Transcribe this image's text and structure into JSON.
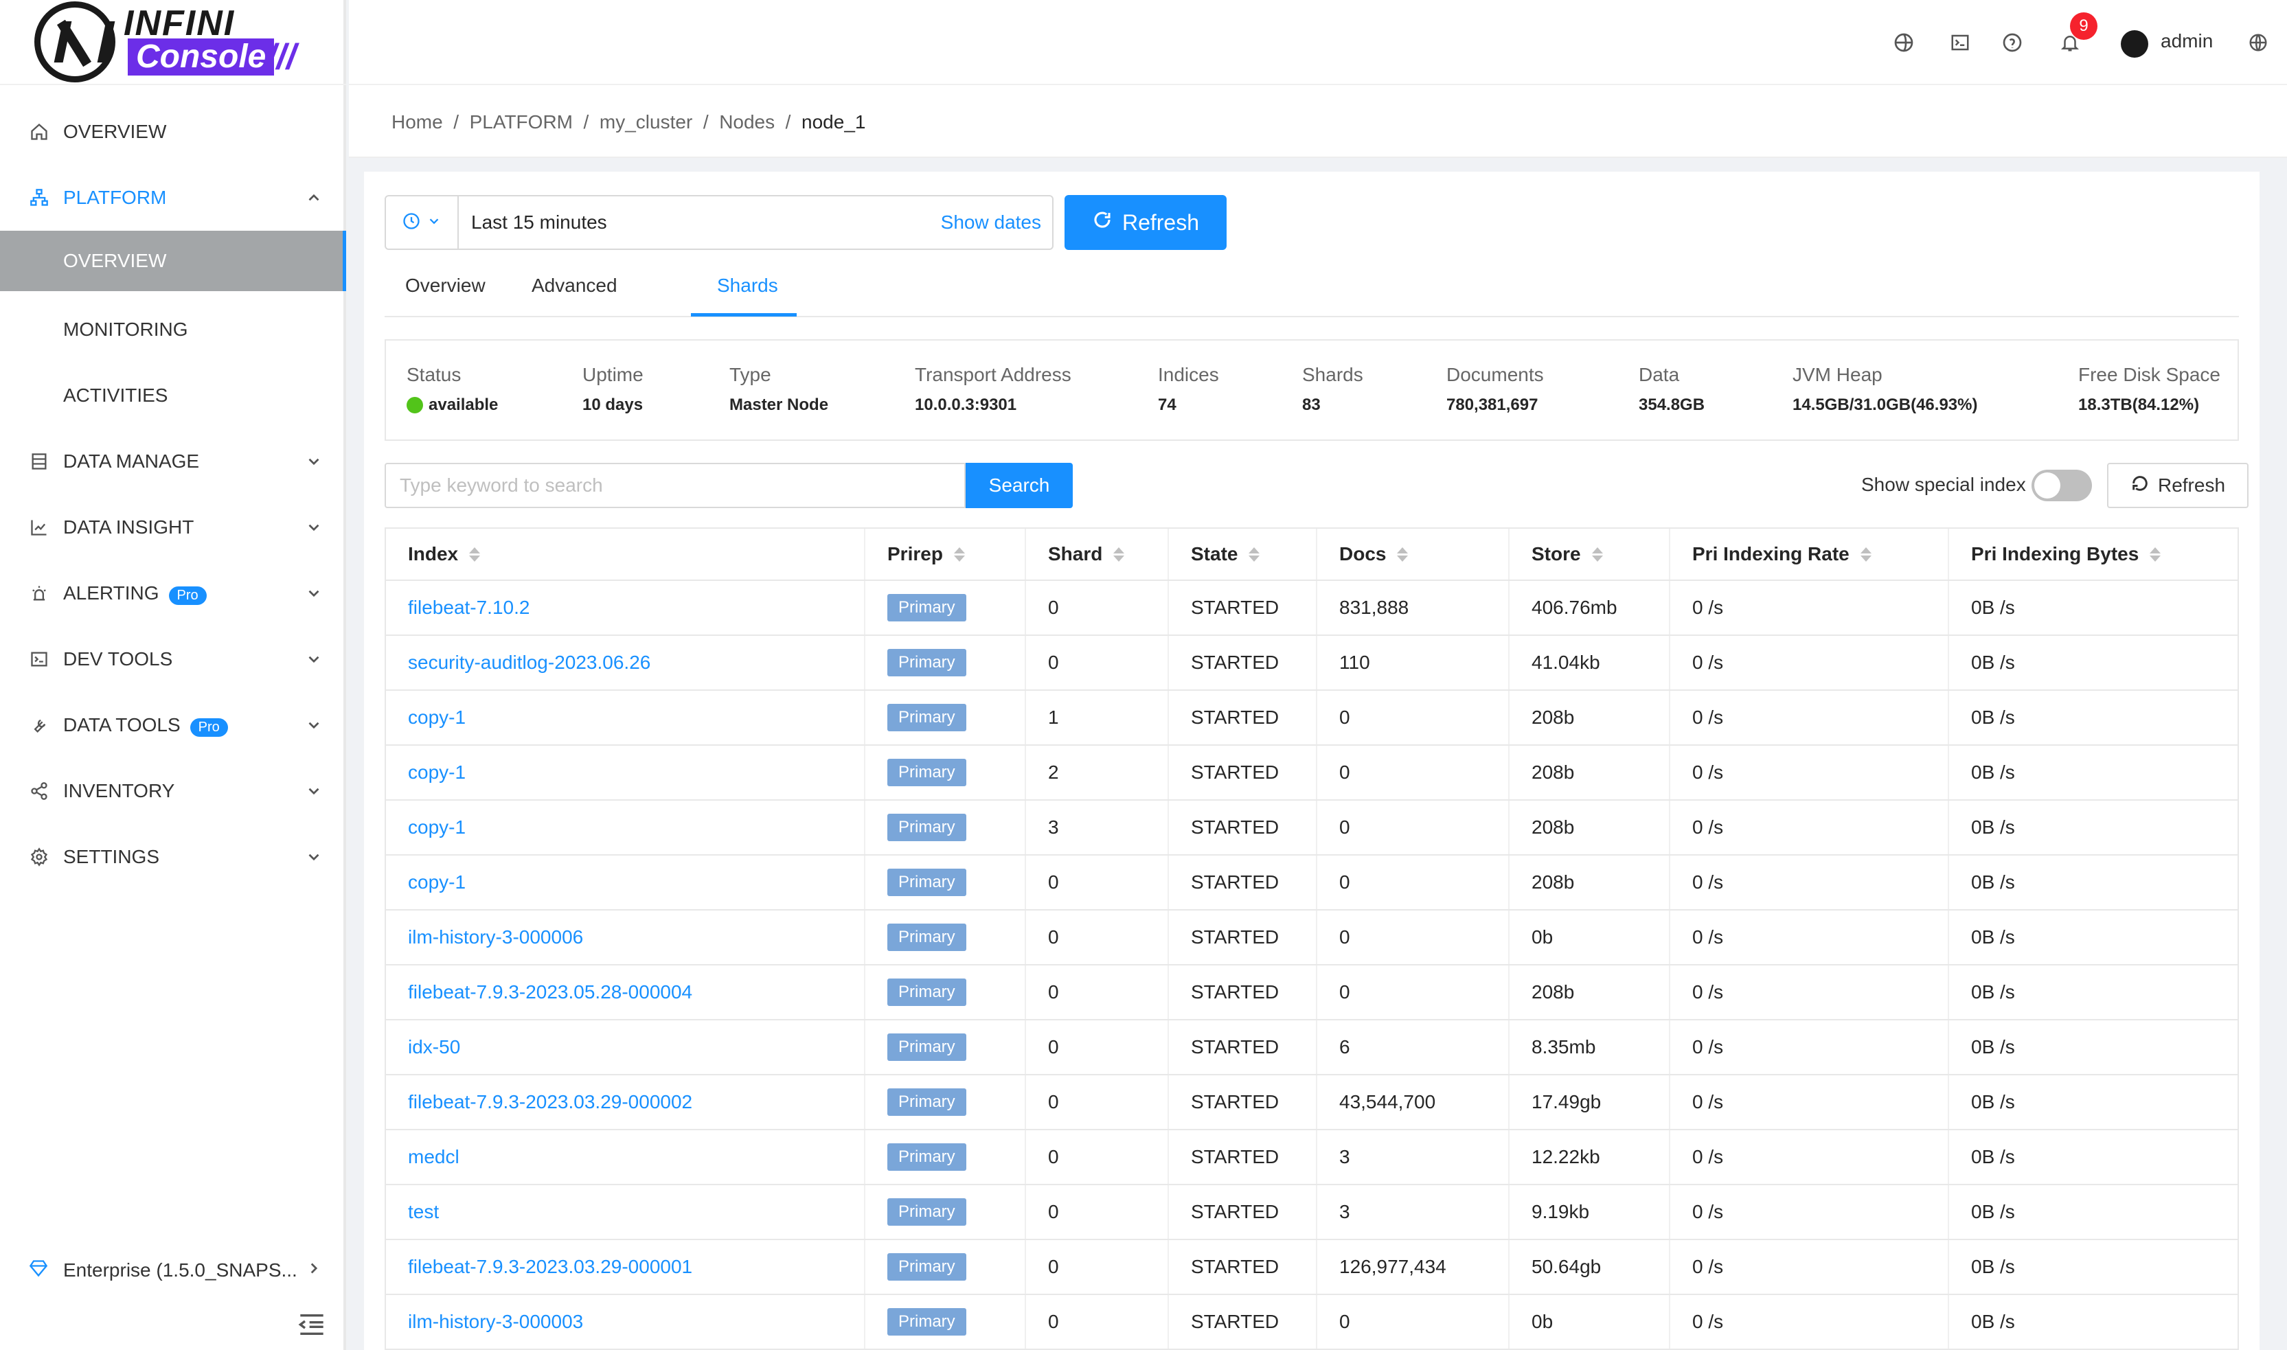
{
  "brand": {
    "top": "INFINI",
    "bottom": "Console",
    "slash": "///"
  },
  "sidebar": {
    "items": [
      {
        "label": "OVERVIEW",
        "icon": "home-icon"
      },
      {
        "label": "PLATFORM",
        "icon": "sitemap-icon"
      },
      {
        "label": "OVERVIEW"
      },
      {
        "label": "MONITORING"
      },
      {
        "label": "ACTIVITIES"
      },
      {
        "label": "DATA MANAGE",
        "icon": "database-icon"
      },
      {
        "label": "DATA INSIGHT",
        "icon": "chart-icon"
      },
      {
        "label": "ALERTING",
        "icon": "alarm-icon",
        "badge": "Pro"
      },
      {
        "label": "DEV TOOLS",
        "icon": "terminal-icon"
      },
      {
        "label": "DATA TOOLS",
        "icon": "wrench-icon",
        "badge": "Pro"
      },
      {
        "label": "INVENTORY",
        "icon": "share-icon"
      },
      {
        "label": "SETTINGS",
        "icon": "gear-icon"
      }
    ],
    "enterprise": "Enterprise (1.5.0_SNAPS..."
  },
  "header": {
    "notifications": "9",
    "user": "admin"
  },
  "breadcrumb": [
    "Home",
    "PLATFORM",
    "my_cluster",
    "Nodes",
    "node_1"
  ],
  "timepicker": {
    "range": "Last 15 minutes",
    "show_dates": "Show dates",
    "refresh": "Refresh"
  },
  "tabs": [
    "Overview",
    "Advanced",
    "Shards"
  ],
  "summary": [
    {
      "k": "Status",
      "v": "available"
    },
    {
      "k": "Uptime",
      "v": "10 days"
    },
    {
      "k": "Type",
      "v": "Master Node"
    },
    {
      "k": "Transport Address",
      "v": "10.0.0.3:9301"
    },
    {
      "k": "Indices",
      "v": "74"
    },
    {
      "k": "Shards",
      "v": "83"
    },
    {
      "k": "Documents",
      "v": "780,381,697"
    },
    {
      "k": "Data",
      "v": "354.8GB"
    },
    {
      "k": "JVM Heap",
      "v": "14.5GB/31.0GB(46.93%)"
    },
    {
      "k": "Free Disk Space",
      "v": "18.3TB(84.12%)"
    }
  ],
  "toolbar": {
    "search_placeholder": "Type keyword to search",
    "search": "Search",
    "show_special": "Show special index",
    "refresh": "Refresh"
  },
  "table": {
    "columns": [
      "Index",
      "Prirep",
      "Shard",
      "State",
      "Docs",
      "Store",
      "Pri Indexing Rate",
      "Pri Indexing Bytes"
    ],
    "rows": [
      [
        "filebeat-7.10.2",
        "Primary",
        "0",
        "STARTED",
        "831,888",
        "406.76mb",
        "0 /s",
        "0B /s"
      ],
      [
        "security-auditlog-2023.06.26",
        "Primary",
        "0",
        "STARTED",
        "110",
        "41.04kb",
        "0 /s",
        "0B /s"
      ],
      [
        "copy-1",
        "Primary",
        "1",
        "STARTED",
        "0",
        "208b",
        "0 /s",
        "0B /s"
      ],
      [
        "copy-1",
        "Primary",
        "2",
        "STARTED",
        "0",
        "208b",
        "0 /s",
        "0B /s"
      ],
      [
        "copy-1",
        "Primary",
        "3",
        "STARTED",
        "0",
        "208b",
        "0 /s",
        "0B /s"
      ],
      [
        "copy-1",
        "Primary",
        "0",
        "STARTED",
        "0",
        "208b",
        "0 /s",
        "0B /s"
      ],
      [
        "ilm-history-3-000006",
        "Primary",
        "0",
        "STARTED",
        "0",
        "0b",
        "0 /s",
        "0B /s"
      ],
      [
        "filebeat-7.9.3-2023.05.28-000004",
        "Primary",
        "0",
        "STARTED",
        "0",
        "208b",
        "0 /s",
        "0B /s"
      ],
      [
        "idx-50",
        "Primary",
        "0",
        "STARTED",
        "6",
        "8.35mb",
        "0 /s",
        "0B /s"
      ],
      [
        "filebeat-7.9.3-2023.03.29-000002",
        "Primary",
        "0",
        "STARTED",
        "43,544,700",
        "17.49gb",
        "0 /s",
        "0B /s"
      ],
      [
        "medcl",
        "Primary",
        "0",
        "STARTED",
        "3",
        "12.22kb",
        "0 /s",
        "0B /s"
      ],
      [
        "test",
        "Primary",
        "0",
        "STARTED",
        "3",
        "9.19kb",
        "0 /s",
        "0B /s"
      ],
      [
        "filebeat-7.9.3-2023.03.29-000001",
        "Primary",
        "0",
        "STARTED",
        "126,977,434",
        "50.64gb",
        "0 /s",
        "0B /s"
      ],
      [
        "ilm-history-3-000003",
        "Primary",
        "0",
        "STARTED",
        "0",
        "0b",
        "0 /s",
        "0B /s"
      ]
    ]
  }
}
